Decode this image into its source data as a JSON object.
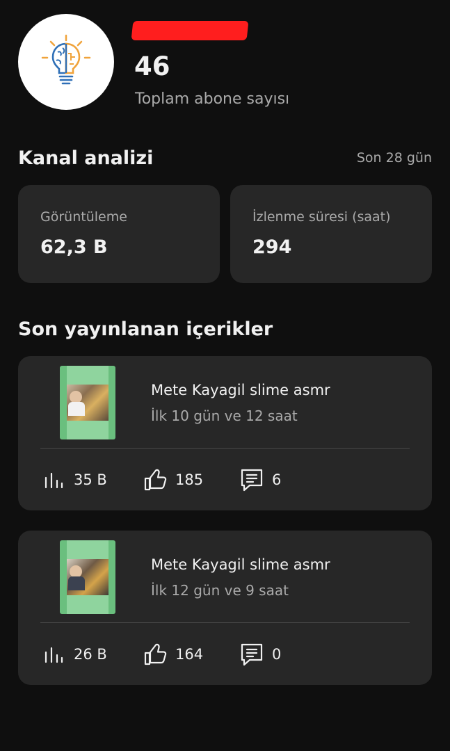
{
  "channel": {
    "subscriber_count": "46",
    "subscriber_label": "Toplam abone sayısı"
  },
  "analytics": {
    "title": "Kanal analizi",
    "period": "Son 28 gün",
    "metrics": [
      {
        "label": "Görüntüleme",
        "value": "62,3 B"
      },
      {
        "label": "İzlenme süresi (saat)",
        "value": "294"
      }
    ]
  },
  "recent": {
    "title": "Son yayınlanan içerikler",
    "videos": [
      {
        "title": "Mete Kayagil slime asmr",
        "meta": "İlk 10 gün ve 12 saat",
        "views": "35 B",
        "likes": "185",
        "comments": "6"
      },
      {
        "title": "Mete Kayagil slime asmr",
        "meta": "İlk 12 gün ve 9 saat",
        "views": "26 B",
        "likes": "164",
        "comments": "0"
      }
    ]
  },
  "icons": {
    "avatar": "lightbulb-brain-icon",
    "views": "bar-chart-icon",
    "likes": "thumbs-up-icon",
    "comments": "comment-icon"
  },
  "colors": {
    "background": "#0f0f0f",
    "card": "#272727",
    "text_primary": "#f1f1f1",
    "text_secondary": "#aaaaaa",
    "redaction": "#ff1e1e",
    "thumbnail_frame": "#6abf7e"
  }
}
